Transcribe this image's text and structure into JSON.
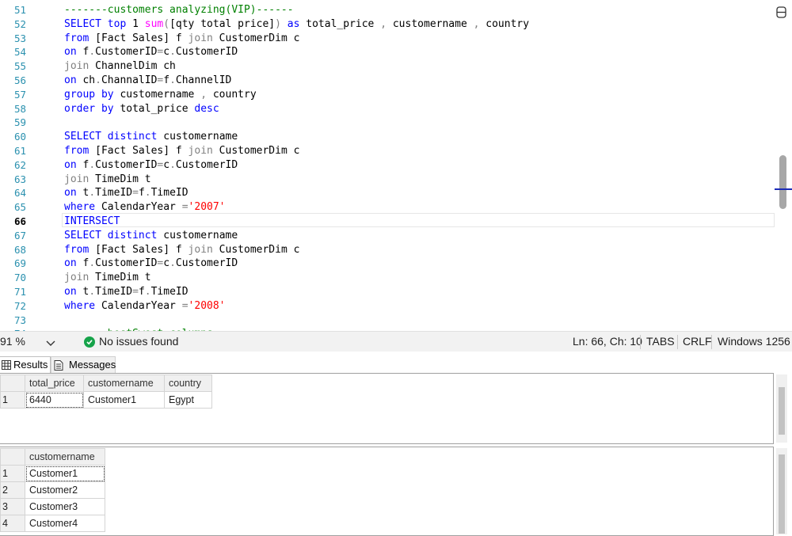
{
  "editor": {
    "current_line": "66",
    "lines": [
      {
        "num": "51",
        "tokens": [
          {
            "t": "-------customers analyzing(VIP)------",
            "c": "cm"
          }
        ]
      },
      {
        "num": "52",
        "tokens": [
          {
            "t": "SELECT",
            "c": "kw"
          },
          {
            "t": " ",
            "c": "plain"
          },
          {
            "t": "top",
            "c": "kw"
          },
          {
            "t": " 1 ",
            "c": "plain"
          },
          {
            "t": "sum",
            "c": "fn"
          },
          {
            "t": "(",
            "c": "gray"
          },
          {
            "t": "[qty total price]",
            "c": "plain"
          },
          {
            "t": ")",
            "c": "gray"
          },
          {
            "t": " ",
            "c": "plain"
          },
          {
            "t": "as",
            "c": "kw"
          },
          {
            "t": " total_price ",
            "c": "plain"
          },
          {
            "t": ",",
            "c": "gray"
          },
          {
            "t": " customername ",
            "c": "plain"
          },
          {
            "t": ",",
            "c": "gray"
          },
          {
            "t": " country",
            "c": "plain"
          }
        ]
      },
      {
        "num": "53",
        "tokens": [
          {
            "t": "from",
            "c": "kw"
          },
          {
            "t": " [Fact Sales] f ",
            "c": "plain"
          },
          {
            "t": "join",
            "c": "gray"
          },
          {
            "t": " CustomerDim c",
            "c": "plain"
          }
        ]
      },
      {
        "num": "54",
        "tokens": [
          {
            "t": "on",
            "c": "kw"
          },
          {
            "t": " f",
            "c": "plain"
          },
          {
            "t": ".",
            "c": "gray"
          },
          {
            "t": "CustomerID",
            "c": "plain"
          },
          {
            "t": "=",
            "c": "gray"
          },
          {
            "t": "c",
            "c": "plain"
          },
          {
            "t": ".",
            "c": "gray"
          },
          {
            "t": "CustomerID",
            "c": "plain"
          }
        ]
      },
      {
        "num": "55",
        "tokens": [
          {
            "t": "join",
            "c": "gray"
          },
          {
            "t": " ChannelDim ch",
            "c": "plain"
          }
        ]
      },
      {
        "num": "56",
        "tokens": [
          {
            "t": "on",
            "c": "kw"
          },
          {
            "t": " ch",
            "c": "plain"
          },
          {
            "t": ".",
            "c": "gray"
          },
          {
            "t": "ChannalID",
            "c": "plain"
          },
          {
            "t": "=",
            "c": "gray"
          },
          {
            "t": "f",
            "c": "plain"
          },
          {
            "t": ".",
            "c": "gray"
          },
          {
            "t": "ChannelID",
            "c": "plain"
          }
        ]
      },
      {
        "num": "57",
        "tokens": [
          {
            "t": "group",
            "c": "kw"
          },
          {
            "t": " ",
            "c": "plain"
          },
          {
            "t": "by",
            "c": "kw"
          },
          {
            "t": " customername ",
            "c": "plain"
          },
          {
            "t": ",",
            "c": "gray"
          },
          {
            "t": " country",
            "c": "plain"
          }
        ]
      },
      {
        "num": "58",
        "tokens": [
          {
            "t": "order",
            "c": "kw"
          },
          {
            "t": " ",
            "c": "plain"
          },
          {
            "t": "by",
            "c": "kw"
          },
          {
            "t": " total_price ",
            "c": "plain"
          },
          {
            "t": "desc",
            "c": "kw"
          }
        ]
      },
      {
        "num": "59",
        "tokens": []
      },
      {
        "num": "60",
        "tokens": [
          {
            "t": "SELECT",
            "c": "kw"
          },
          {
            "t": " ",
            "c": "plain"
          },
          {
            "t": "distinct",
            "c": "kw"
          },
          {
            "t": " customername",
            "c": "plain"
          }
        ]
      },
      {
        "num": "61",
        "tokens": [
          {
            "t": "from",
            "c": "kw"
          },
          {
            "t": " [Fact Sales] f ",
            "c": "plain"
          },
          {
            "t": "join",
            "c": "gray"
          },
          {
            "t": " CustomerDim c",
            "c": "plain"
          }
        ]
      },
      {
        "num": "62",
        "tokens": [
          {
            "t": "on",
            "c": "kw"
          },
          {
            "t": " f",
            "c": "plain"
          },
          {
            "t": ".",
            "c": "gray"
          },
          {
            "t": "CustomerID",
            "c": "plain"
          },
          {
            "t": "=",
            "c": "gray"
          },
          {
            "t": "c",
            "c": "plain"
          },
          {
            "t": ".",
            "c": "gray"
          },
          {
            "t": "CustomerID",
            "c": "plain"
          }
        ]
      },
      {
        "num": "63",
        "tokens": [
          {
            "t": "join",
            "c": "gray"
          },
          {
            "t": " TimeDim t",
            "c": "plain"
          }
        ]
      },
      {
        "num": "64",
        "tokens": [
          {
            "t": "on",
            "c": "kw"
          },
          {
            "t": " t",
            "c": "plain"
          },
          {
            "t": ".",
            "c": "gray"
          },
          {
            "t": "TimeID",
            "c": "plain"
          },
          {
            "t": "=",
            "c": "gray"
          },
          {
            "t": "f",
            "c": "plain"
          },
          {
            "t": ".",
            "c": "gray"
          },
          {
            "t": "TimeID",
            "c": "plain"
          }
        ]
      },
      {
        "num": "65",
        "tokens": [
          {
            "t": "where",
            "c": "kw"
          },
          {
            "t": " CalendarYear ",
            "c": "plain"
          },
          {
            "t": "=",
            "c": "gray"
          },
          {
            "t": "'2007'",
            "c": "str"
          }
        ]
      },
      {
        "num": "66",
        "tokens": [
          {
            "t": "INTERSECT",
            "c": "kw"
          }
        ]
      },
      {
        "num": "67",
        "tokens": [
          {
            "t": "SELECT",
            "c": "kw"
          },
          {
            "t": " ",
            "c": "plain"
          },
          {
            "t": "distinct",
            "c": "kw"
          },
          {
            "t": " customername",
            "c": "plain"
          }
        ]
      },
      {
        "num": "68",
        "tokens": [
          {
            "t": "from",
            "c": "kw"
          },
          {
            "t": " [Fact Sales] f ",
            "c": "plain"
          },
          {
            "t": "join",
            "c": "gray"
          },
          {
            "t": " CustomerDim c",
            "c": "plain"
          }
        ]
      },
      {
        "num": "69",
        "tokens": [
          {
            "t": "on",
            "c": "kw"
          },
          {
            "t": " f",
            "c": "plain"
          },
          {
            "t": ".",
            "c": "gray"
          },
          {
            "t": "CustomerID",
            "c": "plain"
          },
          {
            "t": "=",
            "c": "gray"
          },
          {
            "t": "c",
            "c": "plain"
          },
          {
            "t": ".",
            "c": "gray"
          },
          {
            "t": "CustomerID",
            "c": "plain"
          }
        ]
      },
      {
        "num": "70",
        "tokens": [
          {
            "t": "join",
            "c": "gray"
          },
          {
            "t": " TimeDim t",
            "c": "plain"
          }
        ]
      },
      {
        "num": "71",
        "tokens": [
          {
            "t": "on",
            "c": "kw"
          },
          {
            "t": " t",
            "c": "plain"
          },
          {
            "t": ".",
            "c": "gray"
          },
          {
            "t": "TimeID",
            "c": "plain"
          },
          {
            "t": "=",
            "c": "gray"
          },
          {
            "t": "f",
            "c": "plain"
          },
          {
            "t": ".",
            "c": "gray"
          },
          {
            "t": "TimeID",
            "c": "plain"
          }
        ]
      },
      {
        "num": "72",
        "tokens": [
          {
            "t": "where",
            "c": "kw"
          },
          {
            "t": " CalendarYear ",
            "c": "plain"
          },
          {
            "t": "=",
            "c": "gray"
          },
          {
            "t": "'2008'",
            "c": "str"
          }
        ]
      },
      {
        "num": "73",
        "tokens": []
      },
      {
        "num": "74",
        "tokens": [
          {
            "t": "-------bestSwest-columns",
            "c": "cm"
          }
        ]
      }
    ]
  },
  "statusbar": {
    "zoom": "91 %",
    "issues": "No issues found",
    "position": "Ln: 66, Ch: 10",
    "indent": "TABS",
    "line_ending": "CRLF",
    "encoding": "Windows 1256"
  },
  "results_tabs": {
    "results": "Results",
    "messages": "Messages"
  },
  "result_grid_1": {
    "columns": [
      "total_price",
      "customername",
      "country"
    ],
    "rows": [
      {
        "num": "1",
        "cells": [
          "6440",
          "Customer1",
          "Egypt"
        ]
      }
    ]
  },
  "result_grid_2": {
    "columns": [
      "customername"
    ],
    "rows": [
      {
        "num": "1",
        "cells": [
          "Customer1"
        ]
      },
      {
        "num": "2",
        "cells": [
          "Customer2"
        ]
      },
      {
        "num": "3",
        "cells": [
          "Customer3"
        ]
      },
      {
        "num": "4",
        "cells": [
          "Customer4"
        ]
      }
    ]
  },
  "colors": {
    "keyword": "#0000ff",
    "function": "#ff00ff",
    "string": "#ff0000",
    "comment": "#008000",
    "operator": "#808080",
    "line_number": "#2b91af",
    "status_ok": "#16a34a"
  }
}
